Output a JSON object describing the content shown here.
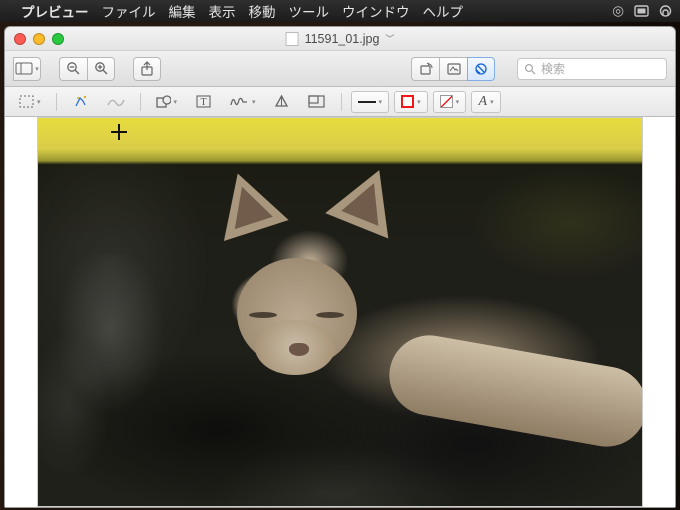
{
  "menubar": {
    "app_name": "プレビュー",
    "items": [
      "ファイル",
      "編集",
      "表示",
      "移動",
      "ツール",
      "ウインドウ",
      "ヘルプ"
    ]
  },
  "window": {
    "filename": "11591_01.jpg"
  },
  "toolbar": {
    "search_placeholder": "検索"
  },
  "markup": {
    "font_label": "A"
  },
  "colors": {
    "stroke": "#f01818"
  }
}
